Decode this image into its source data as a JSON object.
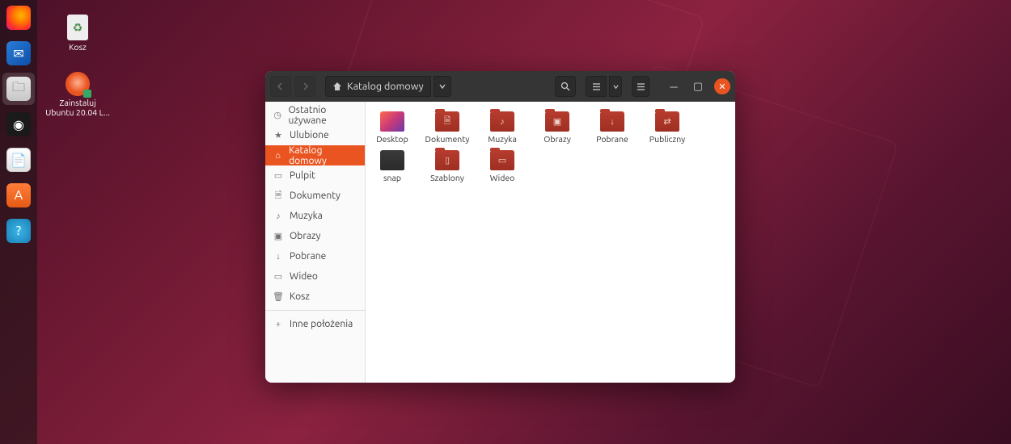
{
  "desktop": {
    "trash_label": "Kosz",
    "installer_label": "Zainstaluj Ubuntu 20.04 L..."
  },
  "dock": {
    "items": [
      "firefox",
      "thunderbird",
      "files",
      "rhythmbox",
      "writer",
      "software",
      "help"
    ]
  },
  "window": {
    "path_label": "Katalog domowy"
  },
  "sidebar": {
    "items": [
      {
        "icon": "clock",
        "label": "Ostatnio używane"
      },
      {
        "icon": "star",
        "label": "Ulubione"
      },
      {
        "icon": "home",
        "label": "Katalog domowy",
        "active": true
      },
      {
        "icon": "screen",
        "label": "Pulpit"
      },
      {
        "icon": "doc",
        "label": "Dokumenty"
      },
      {
        "icon": "music",
        "label": "Muzyka"
      },
      {
        "icon": "image",
        "label": "Obrazy"
      },
      {
        "icon": "download",
        "label": "Pobrane"
      },
      {
        "icon": "video",
        "label": "Wideo"
      },
      {
        "icon": "trash",
        "label": "Kosz"
      }
    ],
    "other_label": "Inne położenia"
  },
  "folders": [
    {
      "name": "Desktop",
      "kind": "desktop"
    },
    {
      "name": "Dokumenty",
      "kind": "doc"
    },
    {
      "name": "Muzyka",
      "kind": "music"
    },
    {
      "name": "Obrazy",
      "kind": "image"
    },
    {
      "name": "Pobrane",
      "kind": "download"
    },
    {
      "name": "Publiczny",
      "kind": "share"
    },
    {
      "name": "snap",
      "kind": "snap"
    },
    {
      "name": "Szablony",
      "kind": "template"
    },
    {
      "name": "Wideo",
      "kind": "video"
    }
  ]
}
